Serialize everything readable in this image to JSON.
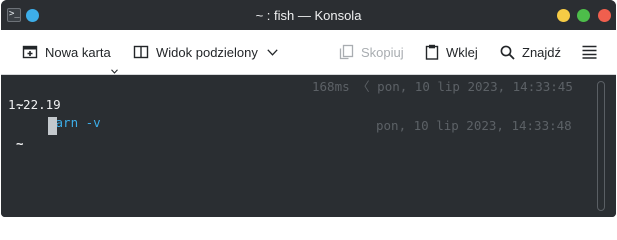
{
  "window": {
    "title": "~ : fish — Konsola",
    "app_icon": "terminal-icon",
    "app_icon_glyph": ">_"
  },
  "toolbar": {
    "new_tab": {
      "label": "Nowa karta",
      "icon": "new-tab-icon"
    },
    "split_view": {
      "label": "Widok podzielony",
      "icon": "split-view-icon"
    },
    "copy": {
      "label": "Skopiuj",
      "icon": "copy-icon",
      "enabled": false
    },
    "paste": {
      "label": "Wklej",
      "icon": "paste-icon"
    },
    "find": {
      "label": "Znajdź",
      "icon": "search-icon"
    },
    "menu": {
      "icon": "hamburger-menu-icon"
    }
  },
  "terminal": {
    "lines": [
      {
        "prompt": "~",
        "command": "yarn -v",
        "right_prompt": "168ms 〈 pon, 10 lip 2023, 14:33:45"
      },
      {
        "output": "1.22.19"
      },
      {
        "prompt": "~",
        "command": "",
        "right_prompt": "pon, 10 lip 2023, 14:33:48"
      }
    ]
  },
  "colors": {
    "terminal_bg": "#2a2e32",
    "command": "#3daee9",
    "right_prompt": "#5c6166",
    "minimize": "#f6cb45",
    "maximize": "#4dbd4a",
    "close": "#f05f4e",
    "pin": "#3daee9"
  }
}
